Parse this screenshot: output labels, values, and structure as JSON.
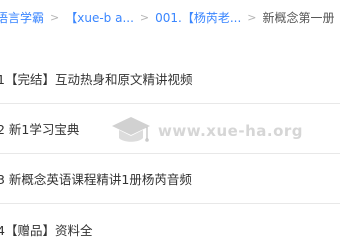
{
  "breadcrumb": {
    "items": [
      "语言学霸",
      "【xue-b a...",
      "001.【杨芮老...",
      "新概念第一册"
    ],
    "separator": ">"
  },
  "list": {
    "items": [
      {
        "label": "1【完结】互动热身和原文精讲视频"
      },
      {
        "label": "2 新1学习宝典"
      },
      {
        "label": "3 新概念英语课程精讲1册杨芮音频"
      },
      {
        "label": "4【赠品】资料全"
      }
    ]
  },
  "watermark": {
    "text": "www.xue-ha.org",
    "icon": "graduation-cap-icon"
  },
  "colors": {
    "link": "#3a86ff",
    "text": "#333333",
    "divider": "#e8e8e8",
    "watermark": "#c8c8c8"
  }
}
